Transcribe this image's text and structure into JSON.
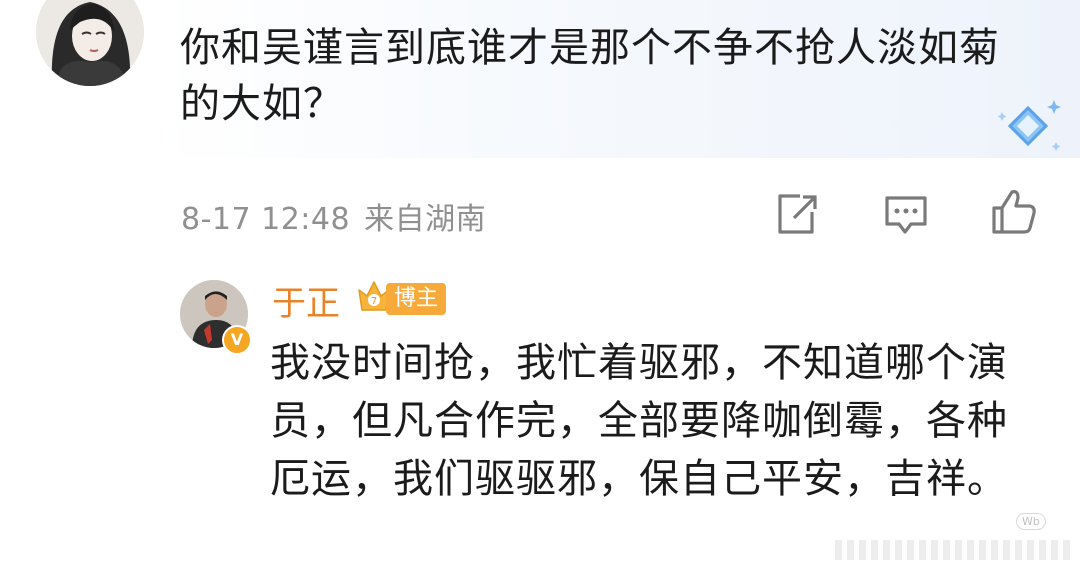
{
  "comment": {
    "text": "你和吴谨言到底谁才是那个不争不抢人淡如菊的大如？",
    "date": "8-17 12:48",
    "location": "来自湖南",
    "badge_icon": "diamond-sparkle-icon",
    "actions": [
      "share-icon",
      "comment-icon",
      "like-icon"
    ]
  },
  "reply": {
    "name": "于正",
    "tag": "博主",
    "vip_icon": "crown-vip-icon",
    "verified_icon": "verified-v-icon",
    "text": "我没时间抢，我忙着驱邪，不知道哪个演员，但凡合作完，全部要降咖倒霉，各种厄运，我们驱驱邪，保自己平安，吉祥。"
  },
  "colors": {
    "text": "#1b1b1b",
    "meta": "#909090",
    "name": "#e8832a",
    "tag_bg": "#f7a93a"
  }
}
